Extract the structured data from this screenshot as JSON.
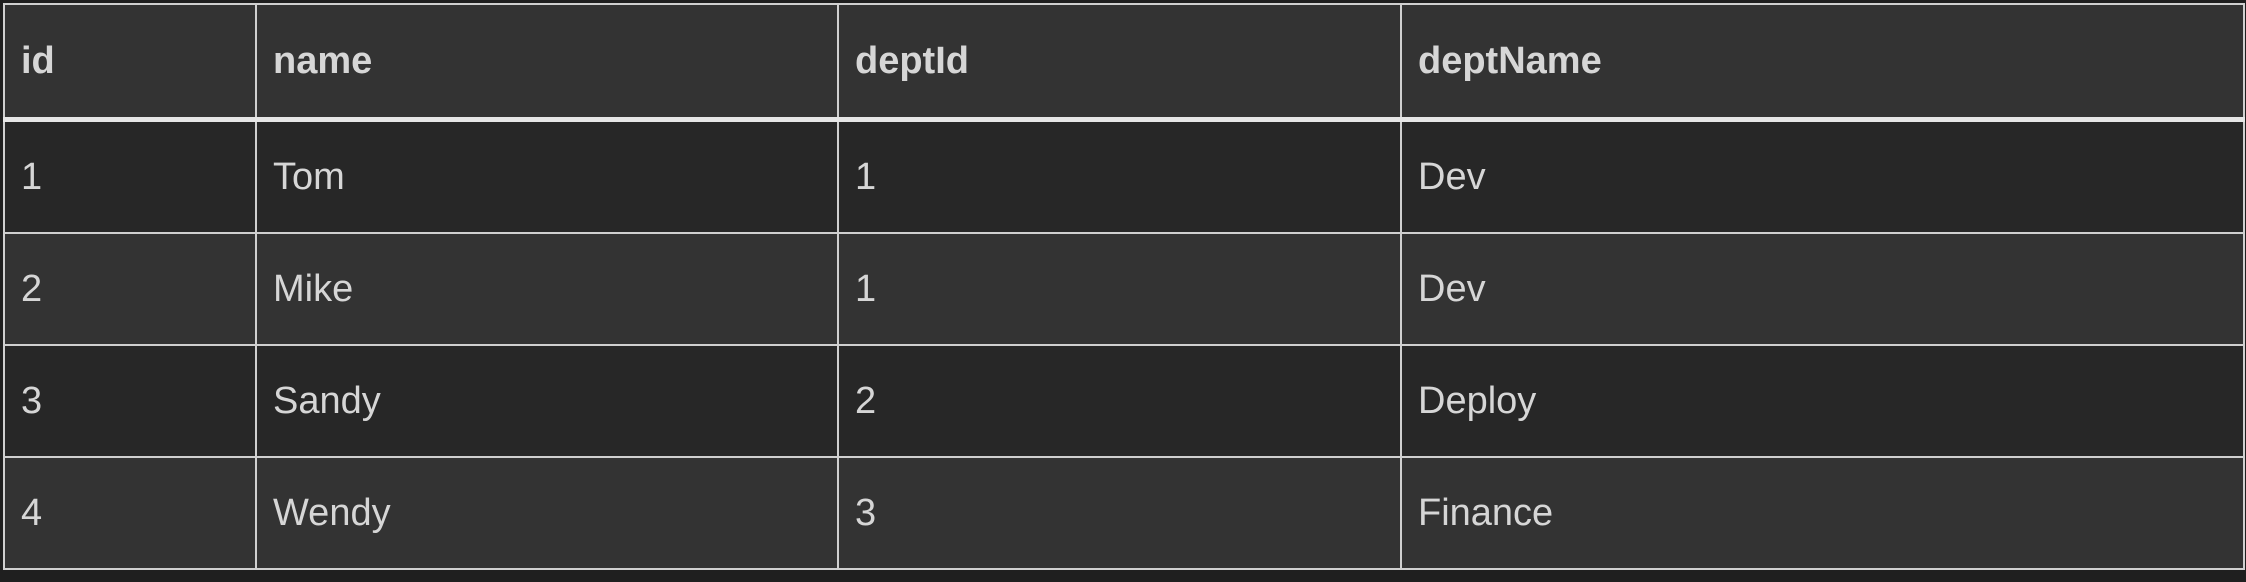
{
  "table": {
    "columns": [
      "id",
      "name",
      "deptId",
      "deptName"
    ],
    "rows": [
      [
        "1",
        "Tom",
        "1",
        "Dev"
      ],
      [
        "2",
        "Mike",
        "1",
        "Dev"
      ],
      [
        "3",
        "Sandy",
        "2",
        "Deploy"
      ],
      [
        "4",
        "Wendy",
        "3",
        "Finance"
      ]
    ]
  },
  "colors": {
    "header_bg": "#333333",
    "row_odd_bg": "#272727",
    "row_even_bg": "#333333",
    "text": "#d6d6d6",
    "border": "#d0d0d0"
  }
}
